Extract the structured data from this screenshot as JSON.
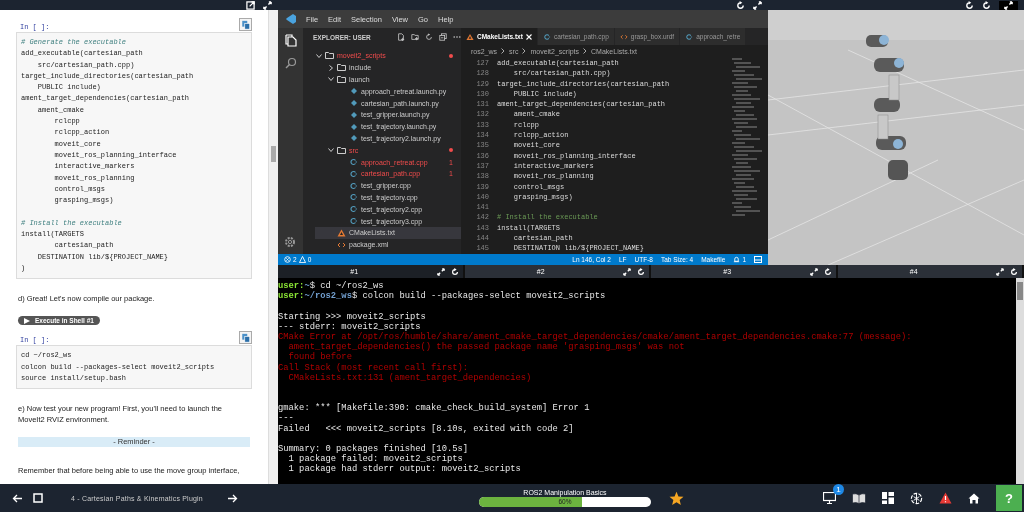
{
  "notebook": {
    "cells": [
      {
        "kind": "code",
        "prompt": "In [ ]:",
        "lines": [
          {
            "kind": "comment",
            "text": "# Generate the executable"
          },
          {
            "kind": "code",
            "text": "add_executable(cartesian_path"
          },
          {
            "kind": "code",
            "text": "    src/cartesian_path.cpp)"
          },
          {
            "kind": "code",
            "text": "target_include_directories(cartesian_path"
          },
          {
            "kind": "code",
            "text": "    PUBLIC include)"
          },
          {
            "kind": "code",
            "text": "ament_target_dependencies(cartesian_path"
          },
          {
            "kind": "code",
            "text": "    ament_cmake"
          },
          {
            "kind": "code",
            "text": "        rclcpp"
          },
          {
            "kind": "code",
            "text": "        rclcpp_action"
          },
          {
            "kind": "code",
            "text": "        moveit_core"
          },
          {
            "kind": "code",
            "text": "        moveit_ros_planning_interface"
          },
          {
            "kind": "code",
            "text": "        interactive_markers"
          },
          {
            "kind": "code",
            "text": "        moveit_ros_planning"
          },
          {
            "kind": "code",
            "text": "        control_msgs"
          },
          {
            "kind": "code",
            "text": "        grasping_msgs)"
          },
          {
            "kind": "blank"
          },
          {
            "kind": "comment",
            "text": "# Install the executable"
          },
          {
            "kind": "code",
            "text": "install(TARGETS"
          },
          {
            "kind": "code",
            "text": "        cartesian_path"
          },
          {
            "kind": "code",
            "text": "    DESTINATION lib/${PROJECT_NAME}"
          },
          {
            "kind": "code",
            "text": ")"
          }
        ]
      },
      {
        "kind": "text",
        "text": "d) Great! Let's now compile our package."
      },
      {
        "kind": "run_button",
        "text": "Execute in Shell #1"
      },
      {
        "kind": "code",
        "prompt": "In [ ]:",
        "lines": [
          {
            "kind": "code",
            "text": "cd ~/ros2_ws"
          },
          {
            "kind": "code",
            "text": "colcon build --packages-select moveit2_scripts"
          },
          {
            "kind": "code",
            "text": "source install/setup.bash"
          }
        ]
      },
      {
        "kind": "text",
        "text": "e) Now test your new program! First, you'll need to launch the MoveIt2 RVIZ environment."
      },
      {
        "kind": "banner",
        "text": "- Reminder -"
      },
      {
        "kind": "text",
        "text": "Remember that before being able to use the move group interface,"
      }
    ]
  },
  "editor": {
    "menu": [
      "File",
      "Edit",
      "Selection",
      "View",
      "Go",
      "Help"
    ],
    "explorer": {
      "title": "EXPLORER: USER",
      "tree": [
        {
          "label": "moveit2_scripts",
          "kind": "folder",
          "expanded": true,
          "modified": true,
          "selected": false,
          "children": [
            {
              "label": "include",
              "kind": "folder",
              "expanded": false,
              "modified": false,
              "selected": false
            },
            {
              "label": "launch",
              "kind": "folder",
              "expanded": true,
              "modified": false,
              "selected": false,
              "children": [
                {
                  "label": "approach_retreat.launch.py",
                  "kind": "python",
                  "modified": false,
                  "selected": false
                },
                {
                  "label": "cartesian_path.launch.py",
                  "kind": "python",
                  "modified": false,
                  "selected": false
                },
                {
                  "label": "test_gripper.launch.py",
                  "kind": "python",
                  "modified": false,
                  "selected": false
                },
                {
                  "label": "test_trajectory.launch.py",
                  "kind": "python",
                  "modified": false,
                  "selected": false
                },
                {
                  "label": "test_trajectory2.launch.py",
                  "kind": "python",
                  "modified": false,
                  "selected": false
                }
              ]
            },
            {
              "label": "src",
              "kind": "folder",
              "expanded": true,
              "modified": true,
              "selected": false,
              "children": [
                {
                  "label": "approach_retreat.cpp",
                  "kind": "cpp",
                  "modified": true,
                  "problems": "1",
                  "selected": false
                },
                {
                  "label": "cartesian_path.cpp",
                  "kind": "cpp",
                  "modified": true,
                  "problems": "1",
                  "selected": false
                },
                {
                  "label": "test_gripper.cpp",
                  "kind": "cpp",
                  "modified": false,
                  "selected": false
                },
                {
                  "label": "test_trajectory.cpp",
                  "kind": "cpp",
                  "modified": false,
                  "selected": false
                },
                {
                  "label": "test_trajectory2.cpp",
                  "kind": "cpp",
                  "modified": false,
                  "selected": false
                },
                {
                  "label": "test_trajectory3.cpp",
                  "kind": "cpp",
                  "modified": false,
                  "selected": false
                }
              ]
            },
            {
              "label": "CMakeLists.txt",
              "kind": "cmake",
              "modified": false,
              "selected": true
            },
            {
              "label": "package.xml",
              "kind": "xml",
              "modified": false,
              "selected": false
            }
          ]
        }
      ]
    },
    "tabs": [
      {
        "label": "CMakeLists.txt",
        "kind": "cmake",
        "selected": true
      },
      {
        "label": "cartesian_path.cpp",
        "kind": "cpp",
        "selected": false
      },
      {
        "label": "grasp_box.urdf",
        "kind": "xml",
        "selected": false
      },
      {
        "label": "approach_retre",
        "kind": "cpp",
        "selected": false
      }
    ],
    "breadcrumbs": [
      "ros2_ws",
      "src",
      "moveit2_scripts",
      "CMakeLists.txt"
    ],
    "lines": [
      {
        "number": "127",
        "kind": "code",
        "text": "add_executable(cartesian_path"
      },
      {
        "number": "128",
        "kind": "code",
        "text": "    src/cartesian_path.cpp)"
      },
      {
        "number": "129",
        "kind": "code",
        "text": "target_include_directories(cartesian_path"
      },
      {
        "number": "130",
        "kind": "code",
        "text": "    PUBLIC include)"
      },
      {
        "number": "131",
        "kind": "code",
        "text": "ament_target_dependencies(cartesian_path"
      },
      {
        "number": "132",
        "kind": "code",
        "text": "    ament_cmake"
      },
      {
        "number": "133",
        "kind": "code",
        "text": "    rclcpp"
      },
      {
        "number": "134",
        "kind": "code",
        "text": "    rclcpp_action"
      },
      {
        "number": "135",
        "kind": "code",
        "text": "    moveit_core"
      },
      {
        "number": "136",
        "kind": "code",
        "text": "    moveit_ros_planning_interface"
      },
      {
        "number": "137",
        "kind": "code",
        "text": "    interactive_markers"
      },
      {
        "number": "138",
        "kind": "code",
        "text": "    moveit_ros_planning"
      },
      {
        "number": "139",
        "kind": "code",
        "text": "    control_msgs"
      },
      {
        "number": "140",
        "kind": "code",
        "text": "    grasping_msgs)"
      },
      {
        "number": "141",
        "kind": "blank"
      },
      {
        "number": "142",
        "kind": "comment",
        "text": "# Install the executable"
      },
      {
        "number": "143",
        "kind": "code",
        "text": "install(TARGETS"
      },
      {
        "number": "144",
        "kind": "code",
        "text": "    cartesian_path"
      },
      {
        "number": "145",
        "kind": "code",
        "text": "    DESTINATION lib/${PROJECT_NAME}"
      }
    ],
    "status_bar": {
      "errors": "2",
      "warnings": "0",
      "items": [
        "Ln 146, Col 2",
        "LF",
        "UTF-8",
        "Tab Size: 4",
        "Makefile"
      ],
      "notifications": "1"
    }
  },
  "terminal": {
    "tabs": [
      {
        "label": "#1",
        "selected": true
      },
      {
        "label": "#2",
        "selected": false
      },
      {
        "label": "#3",
        "selected": false
      },
      {
        "label": "#4",
        "selected": false
      }
    ],
    "lines": [
      {
        "kind": "prompt",
        "user": "user:",
        "path": "~",
        "command": "$ cd ~/ros2_ws"
      },
      {
        "kind": "prompt",
        "user": "user:",
        "path": "~/ros2_ws",
        "command": "$ colcon build --packages-select moveit2_scripts"
      },
      {
        "kind": "blank"
      },
      {
        "kind": "output",
        "text": "Starting >>> moveit2_scripts"
      },
      {
        "kind": "output",
        "text": "--- stderr: moveit2_scripts"
      },
      {
        "kind": "error",
        "text": "CMake Error at /opt/ros/humble/share/ament_cmake_target_dependencies/cmake/ament_target_dependencies.cmake:77 (message):"
      },
      {
        "kind": "error",
        "text": "  ament_target_dependencies() the passed package name 'grasping_msgs' was not"
      },
      {
        "kind": "error",
        "text": "  found before"
      },
      {
        "kind": "error",
        "text": "Call Stack (most recent call first):"
      },
      {
        "kind": "error",
        "text": "  CMakeLists.txt:131 (ament_target_dependencies)"
      },
      {
        "kind": "blank"
      },
      {
        "kind": "blank"
      },
      {
        "kind": "output",
        "text": "gmake: *** [Makefile:390: cmake_check_build_system] Error 1"
      },
      {
        "kind": "output",
        "text": "---"
      },
      {
        "kind": "output",
        "text": "Failed   <<< moveit2_scripts [8.10s, exited with code 2]"
      },
      {
        "kind": "blank"
      },
      {
        "kind": "output",
        "text": "Summary: 0 packages finished [10.5s]"
      },
      {
        "kind": "output",
        "text": "  1 package failed: moveit2_scripts"
      },
      {
        "kind": "output",
        "text": "  1 package had stderr output: moveit2_scripts"
      }
    ]
  },
  "bottom_bar": {
    "lesson": "4 - Cartesian Paths & Kinematics Plugin",
    "course": "ROS2 Manipulation Basics",
    "progress": {
      "level": 0.6,
      "reading": "60%"
    },
    "notification_badge": "1",
    "help": "?"
  }
}
